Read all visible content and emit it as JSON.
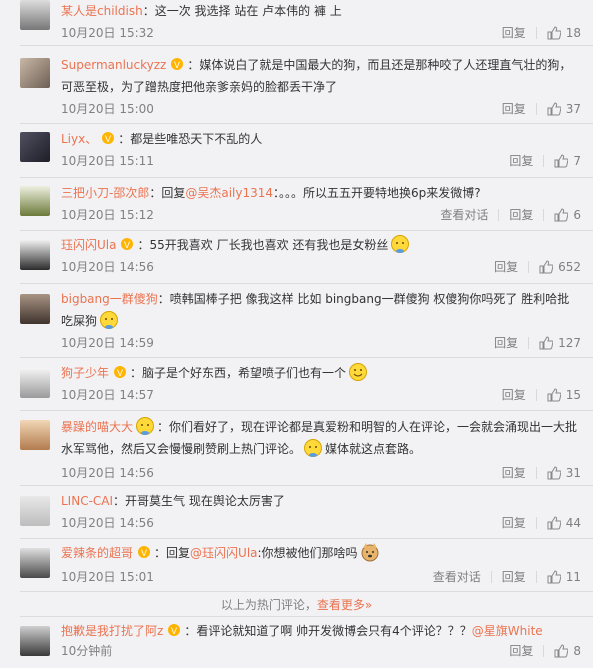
{
  "comments": [
    {
      "user": "某人是childish",
      "vip": false,
      "text": "：这一次 我选择 站在 卢本伟的 褲 上",
      "time": "10月20日 15:32",
      "reply": "回复",
      "likes": "18"
    },
    {
      "user": "Supermanluckyzz",
      "vip": true,
      "text": "：媒体说白了就是中国最大的狗，而且还是那种咬了人还理直气壮的狗，可恶至极，为了蹭热度把他亲爹亲妈的脸都丢干净了",
      "time": "10月20日 15:00",
      "reply": "回复",
      "likes": "37"
    },
    {
      "user": "Liyx、",
      "vip": true,
      "text": "：都是些唯恐天下不乱的人",
      "time": "10月20日 15:11",
      "reply": "回复",
      "likes": "7"
    },
    {
      "user": "三把小刀-邵次郎",
      "vip": false,
      "text": "：回复",
      "mention": "@吴杰aily1314",
      "text2": "：。。。所以五五开要特地换6p来发微博?",
      "time": "10月20日 15:12",
      "view_conv": "查看对话",
      "reply": "回复",
      "likes": "6"
    },
    {
      "user": "珏闪闪Ula",
      "vip": true,
      "text": "：55开我喜欢 厂长我也喜欢 还有我也是女粉丝",
      "time": "10月20日 14:56",
      "reply": "回复",
      "likes": "652"
    },
    {
      "user": "bigbang一群傻狗",
      "vip": false,
      "text": "：喷韩国棒子把 像我这样 比如 bingbang一群傻狗 权傻狗你吗死了 胜利哈批吃屎狗",
      "time": "10月20日 14:59",
      "reply": "回复",
      "likes": "127"
    },
    {
      "user": "狗子少年",
      "vip": true,
      "text": "：脑子是个好东西，希望喷子们也有一个",
      "time": "10月20日 14:57",
      "reply": "回复",
      "likes": "15"
    },
    {
      "user": "暴躁的喵大大",
      "vip": false,
      "text": "：你们看好了，现在评论都是真爱粉和明智的人在评论，一会就会涌现出一大批水军骂他，然后又会慢慢刷赞刷上热门评论。",
      "text2": "媒体就这点套路。",
      "time": "10月20日 14:56",
      "reply": "回复",
      "likes": "31"
    },
    {
      "user": "LINC-CAI",
      "vip": false,
      "text": "：开哥莫生气 现在舆论太厉害了",
      "time": "10月20日 14:56",
      "reply": "回复",
      "likes": "44"
    },
    {
      "user": "爱辣条的超哥",
      "vip": true,
      "text": "：回复",
      "mention": "@珏闪闪Ula",
      "text2": ":你想被他们那啥吗",
      "time": "10月20日 15:01",
      "view_conv": "查看对话",
      "reply": "回复",
      "likes": "11"
    },
    {
      "user": "抱歉是我打扰了阿z",
      "vip": true,
      "text": "：看评论就知道了啊  帅开发微博会只有4个评论？？？",
      "mention": "@星旗White",
      "time": "10分钟前",
      "reply": "回复",
      "likes": "8"
    }
  ],
  "hot_footer": {
    "label": "以上为热门评论，",
    "more": "查看更多»"
  }
}
